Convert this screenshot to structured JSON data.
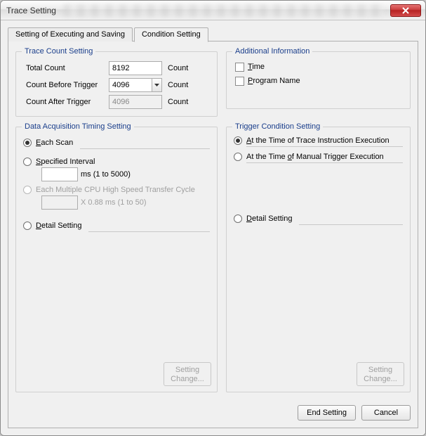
{
  "window": {
    "title": "Trace Setting"
  },
  "tabs": {
    "exec_save": "Setting of Executing and Saving",
    "condition": "Condition Setting"
  },
  "trace_count": {
    "legend": "Trace Count Setting",
    "total_label": "Total Count",
    "total_value": "8192",
    "before_label": "Count Before Trigger",
    "before_value": "4096",
    "after_label": "Count After Trigger",
    "after_value": "4096",
    "unit": "Count"
  },
  "addl_info": {
    "legend": "Additional Information",
    "time": "Time",
    "program_name": "Program Name"
  },
  "daq": {
    "legend": "Data Acquisition Timing Setting",
    "each_scan": "Each Scan",
    "specified_interval": "Specified Interval",
    "interval_unit": "ms (1 to 5000)",
    "mult_cpu": "Each Multiple CPU High Speed Transfer Cycle",
    "mult_cpu_unit": "X 0.88 ms (1 to 50)",
    "detail": "Detail Setting",
    "setting_change": "Setting\nChange..."
  },
  "trigger": {
    "legend": "Trigger Condition Setting",
    "instr_exec": "At the Time of Trace Instruction Execution",
    "manual_exec": "At the Time of Manual Trigger Execution",
    "detail": "Detail Setting",
    "setting_change": "Setting\nChange..."
  },
  "footer": {
    "end": "End Setting",
    "cancel": "Cancel"
  }
}
